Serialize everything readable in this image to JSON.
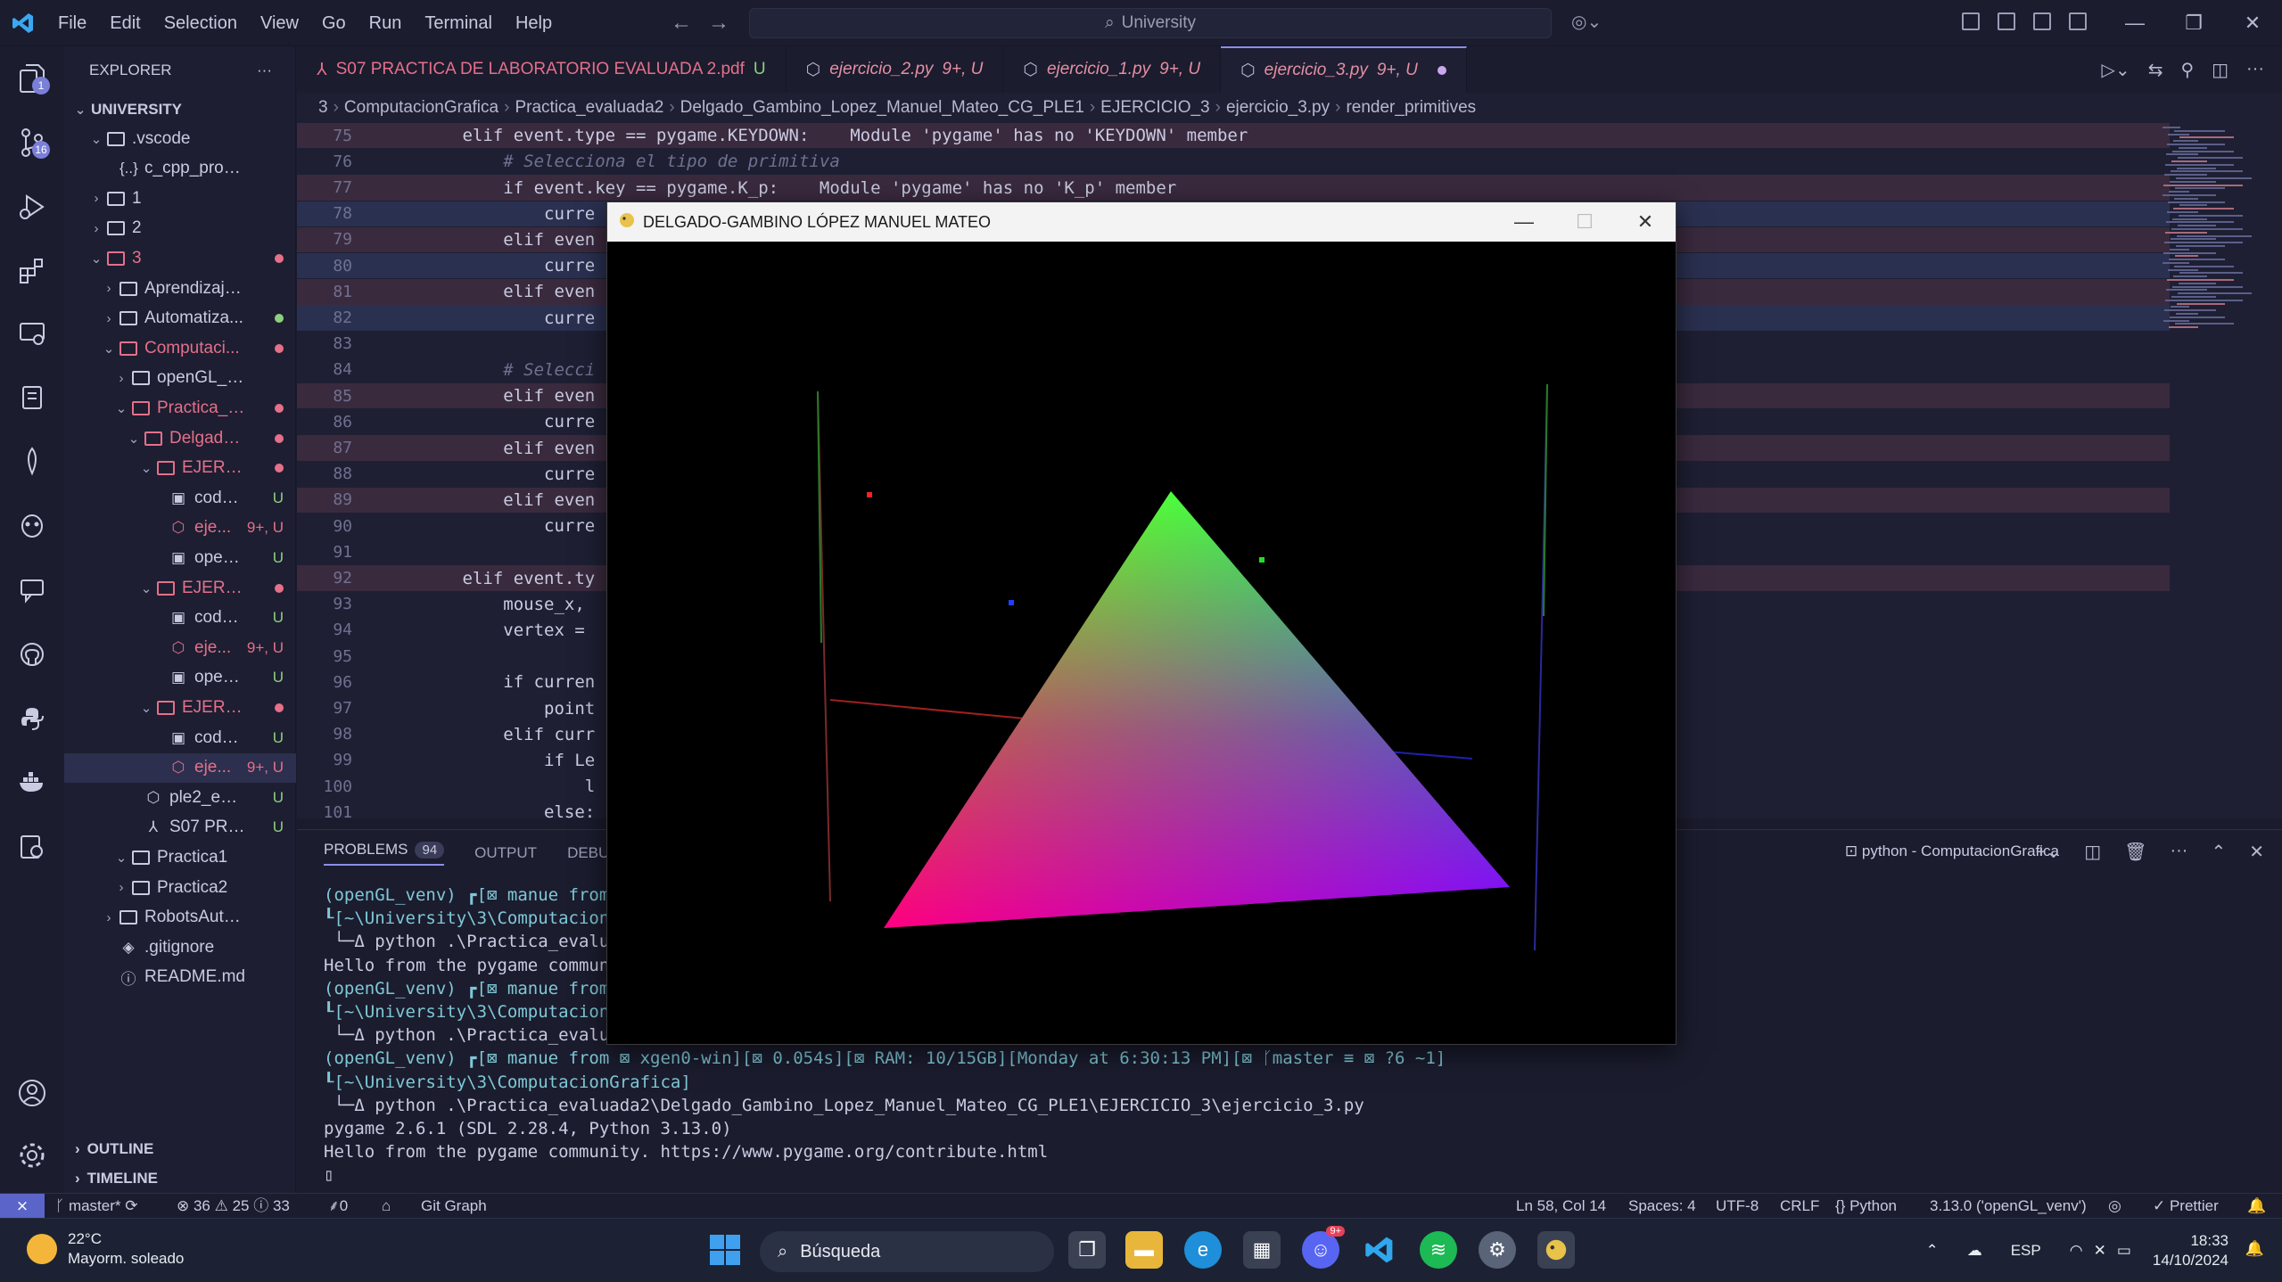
{
  "titlebar": {
    "menus": [
      "File",
      "Edit",
      "Selection",
      "View",
      "Go",
      "Run",
      "Terminal",
      "Help"
    ],
    "search_text": "University"
  },
  "activity": {
    "badges": {
      "extensions": "1",
      "source_control": "16"
    }
  },
  "explorer": {
    "title": "EXPLORER",
    "more": "···",
    "root": "UNIVERSITY",
    "rows": [
      {
        "label": ".vscode",
        "type": "folder",
        "open": true,
        "indent": 0,
        "status": "",
        "status_color": ""
      },
      {
        "label": "c_cpp_properties...",
        "type": "file",
        "icon": "{..}",
        "indent": 1,
        "status": "",
        "status_color": ""
      },
      {
        "label": "1",
        "type": "folder",
        "open": false,
        "indent": 0,
        "status": "",
        "status_color": ""
      },
      {
        "label": "2",
        "type": "folder",
        "open": false,
        "indent": 0,
        "status": "",
        "status_color": ""
      },
      {
        "label": "3",
        "type": "folder",
        "open": true,
        "indent": 0,
        "status": "dot",
        "status_color": "#e5708a",
        "labelcolor": "#e5708a"
      },
      {
        "label": "AprendizajeAuto...",
        "type": "folder",
        "open": false,
        "indent": 1,
        "status": "",
        "status_color": ""
      },
      {
        "label": "Automatiza...",
        "type": "folder",
        "open": false,
        "indent": 1,
        "status": "dot",
        "status_color": "#8ccf7e"
      },
      {
        "label": "Computaci...",
        "type": "folder",
        "open": true,
        "indent": 1,
        "status": "dot",
        "status_color": "#e5708a",
        "labelcolor": "#e5708a"
      },
      {
        "label": "openGL_venv",
        "type": "folder",
        "open": false,
        "indent": 2,
        "status": "",
        "status_color": ""
      },
      {
        "label": "Practica_e...",
        "type": "folder",
        "open": true,
        "indent": 2,
        "status": "dot",
        "status_color": "#e5708a",
        "labelcolor": "#e5708a"
      },
      {
        "label": "Delgado...",
        "type": "folder",
        "open": true,
        "indent": 3,
        "status": "dot",
        "status_color": "#e5708a",
        "labelcolor": "#e5708a"
      },
      {
        "label": "EJERCI...",
        "type": "folder",
        "open": true,
        "indent": 4,
        "status": "dot",
        "status_color": "#e5708a",
        "labelcolor": "#e5708a"
      },
      {
        "label": "code_...",
        "type": "file",
        "icon": "▣",
        "indent": 5,
        "status": "U",
        "status_color": "#8ccf7e"
      },
      {
        "label": "eje...",
        "type": "file",
        "icon": "⬡",
        "indent": 5,
        "status": "9+, U",
        "status_color": "#e5708a",
        "labelcolor": "#e5708a"
      },
      {
        "label": "openg...",
        "type": "file",
        "icon": "▣",
        "indent": 5,
        "status": "U",
        "status_color": "#8ccf7e"
      },
      {
        "label": "EJERCI...",
        "type": "folder",
        "open": true,
        "indent": 4,
        "status": "dot",
        "status_color": "#e5708a",
        "labelcolor": "#e5708a"
      },
      {
        "label": "code_...",
        "type": "file",
        "icon": "▣",
        "indent": 5,
        "status": "U",
        "status_color": "#8ccf7e"
      },
      {
        "label": "eje...",
        "type": "file",
        "icon": "⬡",
        "indent": 5,
        "status": "9+, U",
        "status_color": "#e5708a",
        "labelcolor": "#e5708a"
      },
      {
        "label": "openg...",
        "type": "file",
        "icon": "▣",
        "indent": 5,
        "status": "U",
        "status_color": "#8ccf7e"
      },
      {
        "label": "EJERCI...",
        "type": "folder",
        "open": true,
        "indent": 4,
        "status": "dot",
        "status_color": "#e5708a",
        "labelcolor": "#e5708a"
      },
      {
        "label": "code_...",
        "type": "file",
        "icon": "▣",
        "indent": 5,
        "status": "U",
        "status_color": "#8ccf7e"
      },
      {
        "label": "eje...",
        "type": "file",
        "icon": "⬡",
        "indent": 5,
        "status": "9+, U",
        "status_color": "#e5708a",
        "labelcolor": "#e5708a",
        "selected": true
      },
      {
        "label": "ple2_enu...",
        "type": "file",
        "icon": "⬡",
        "indent": 3,
        "status": "U",
        "status_color": "#8ccf7e"
      },
      {
        "label": "S07 PRA...",
        "type": "file",
        "icon": "⅄",
        "indent": 3,
        "status": "U",
        "status_color": "#8ccf7e"
      },
      {
        "label": "Practica1",
        "type": "folder",
        "open": true,
        "indent": 2,
        "status": "",
        "status_color": ""
      },
      {
        "label": "Practica2",
        "type": "folder",
        "open": false,
        "indent": 2,
        "status": "",
        "status_color": ""
      },
      {
        "label": "RobotsAutonomos",
        "type": "folder",
        "open": false,
        "indent": 1,
        "status": "",
        "status_color": ""
      },
      {
        "label": ".gitignore",
        "type": "file",
        "icon": "◈",
        "indent": 1,
        "status": "",
        "status_color": ""
      },
      {
        "label": "README.md",
        "type": "file",
        "icon": "ⓘ",
        "indent": 1,
        "status": "",
        "status_color": ""
      }
    ],
    "outline": "OUTLINE",
    "timeline": "TIMELINE"
  },
  "tabs": [
    {
      "name": "S07 PRACTICA DE LABORATORIO EVALUADA 2.pdf",
      "status": "U",
      "kind": "pdf"
    },
    {
      "name": "ejercicio_2.py",
      "status": "9+, U",
      "kind": "py"
    },
    {
      "name": "ejercicio_1.py",
      "status": "9+, U",
      "kind": "py"
    },
    {
      "name": "ejercicio_3.py",
      "status": "9+, U",
      "kind": "py",
      "active": true
    }
  ],
  "breadcrumb": [
    "3",
    "ComputacionGrafica",
    "Practica_evaluada2",
    "Delgado_Gambino_Lopez_Manuel_Mateo_CG_PLE1",
    "EJERCICIO_3",
    "ejercicio_3.py",
    "render_primitives"
  ],
  "code_lines": [
    {
      "n": "75",
      "text": "        elif event.type == pygame.KEYDOWN:    Module 'pygame' has no 'KEYDOWN' member",
      "hl": "red"
    },
    {
      "n": "76",
      "text": "            # Selecciona el tipo de primitiva",
      "hl": ""
    },
    {
      "n": "77",
      "text": "            if event.key == pygame.K_p:    Module 'pygame' has no 'K_p' member",
      "hl": "red"
    },
    {
      "n": "78",
      "text": "                curre                                                                                       ng style",
      "hl": "blue"
    },
    {
      "n": "79",
      "text": "            elif even",
      "hl": "red"
    },
    {
      "n": "80",
      "text": "                curre                                                                                       ng style",
      "hl": "blue"
    },
    {
      "n": "81",
      "text": "            elif even",
      "hl": "red"
    },
    {
      "n": "82",
      "text": "                curre                                                                                     naming style",
      "hl": "blue"
    },
    {
      "n": "83",
      "text": "",
      "hl": ""
    },
    {
      "n": "84",
      "text": "            # Selecci",
      "hl": ""
    },
    {
      "n": "85",
      "text": "            elif even",
      "hl": "red"
    },
    {
      "n": "86",
      "text": "                curre",
      "hl": ""
    },
    {
      "n": "87",
      "text": "            elif even",
      "hl": "red"
    },
    {
      "n": "88",
      "text": "                curre",
      "hl": ""
    },
    {
      "n": "89",
      "text": "            elif even",
      "hl": "red"
    },
    {
      "n": "90",
      "text": "                curre",
      "hl": ""
    },
    {
      "n": "91",
      "text": "",
      "hl": ""
    },
    {
      "n": "92",
      "text": "        elif event.ty",
      "hl": "red"
    },
    {
      "n": "93",
      "text": "            mouse_x, ",
      "hl": ""
    },
    {
      "n": "94",
      "text": "            vertex = ",
      "hl": ""
    },
    {
      "n": "95",
      "text": "",
      "hl": ""
    },
    {
      "n": "96",
      "text": "            if curren",
      "hl": ""
    },
    {
      "n": "97",
      "text": "                point",
      "hl": ""
    },
    {
      "n": "98",
      "text": "            elif curr",
      "hl": ""
    },
    {
      "n": "99",
      "text": "                if Le",
      "hl": ""
    },
    {
      "n": "100",
      "text": "                    l",
      "hl": ""
    },
    {
      "n": "101",
      "text": "                else:",
      "hl": ""
    }
  ],
  "panel": {
    "tabs": [
      "PROBLEMS",
      "OUTPUT",
      "DEBUG"
    ],
    "problems_count": "94",
    "terminal_title": "python - ComputacionGrafica",
    "terminal_lines": [
      {
        "text": "(openGL_venv) ┏[⊠ manue from ",
        "cls": "tcy"
      },
      {
        "text": "┖[~\\University\\3\\ComputacionG",
        "cls": "tcy"
      },
      {
        "text": " └─Δ python .\\Practica_evaluad",
        "cls": ""
      },
      {
        "text": "Hello from the pygame communi",
        "cls": ""
      },
      {
        "text": "(openGL_venv) ┏[⊠ manue from ",
        "cls": "tcy"
      },
      {
        "text": "┖[~\\University\\3\\ComputacionG",
        "cls": "tcy"
      },
      {
        "text": " └─Δ python .\\Practica_evaluada2\\Delgado_Gambino_Lopez_Manuel_Mateo_CG_PLE1\\EJERCICIO_3\\ejercicio_3.py",
        "cls": ""
      },
      {
        "text": "(openGL_venv) ┏[⊠ manue from ⊠ xgen0-win][⊠ 0.054s][⊠ RAM: 10/15GB][Monday at 6:30:13 PM][⊠ ᚴmaster ≡ ⊠ ?6 ~1]",
        "cls": "tcy"
      },
      {
        "text": "┖[~\\University\\3\\ComputacionGrafica]",
        "cls": "tcy"
      },
      {
        "text": " └─Δ python .\\Practica_evaluada2\\Delgado_Gambino_Lopez_Manuel_Mateo_CG_PLE1\\EJERCICIO_3\\ejercicio_3.py",
        "cls": ""
      },
      {
        "text": "pygame 2.6.1 (SDL 2.28.4, Python 3.13.0)",
        "cls": ""
      },
      {
        "text": "Hello from the pygame community. https://www.pygame.org/contribute.html",
        "cls": ""
      },
      {
        "text": "▯",
        "cls": ""
      }
    ]
  },
  "statusbar": {
    "branch": "master*",
    "sync": "⟳",
    "errors": "⊗ 36",
    "warnings": "⚠ 25",
    "infos": "ⓘ 33",
    "ports": "⸙0",
    "home": "⌂",
    "git_graph": "Git Graph",
    "position": "Ln 58, Col 14",
    "spaces": "Spaces: 4",
    "encoding": "UTF-8",
    "eol": "CRLF",
    "language": "{} Python",
    "interpreter": "3.13.0 ('openGL_venv')",
    "prettier": "✓ Prettier"
  },
  "pygame_window": {
    "title": "DELGADO-GAMBINO LÓPEZ MANUEL MATEO"
  },
  "taskbar": {
    "temp": "22°C",
    "weather": "Mayorm. soleado",
    "search": "Búsqueda",
    "lang": "ESP",
    "time": "18:33",
    "date": "14/10/2024",
    "discord_badge": "9+"
  }
}
